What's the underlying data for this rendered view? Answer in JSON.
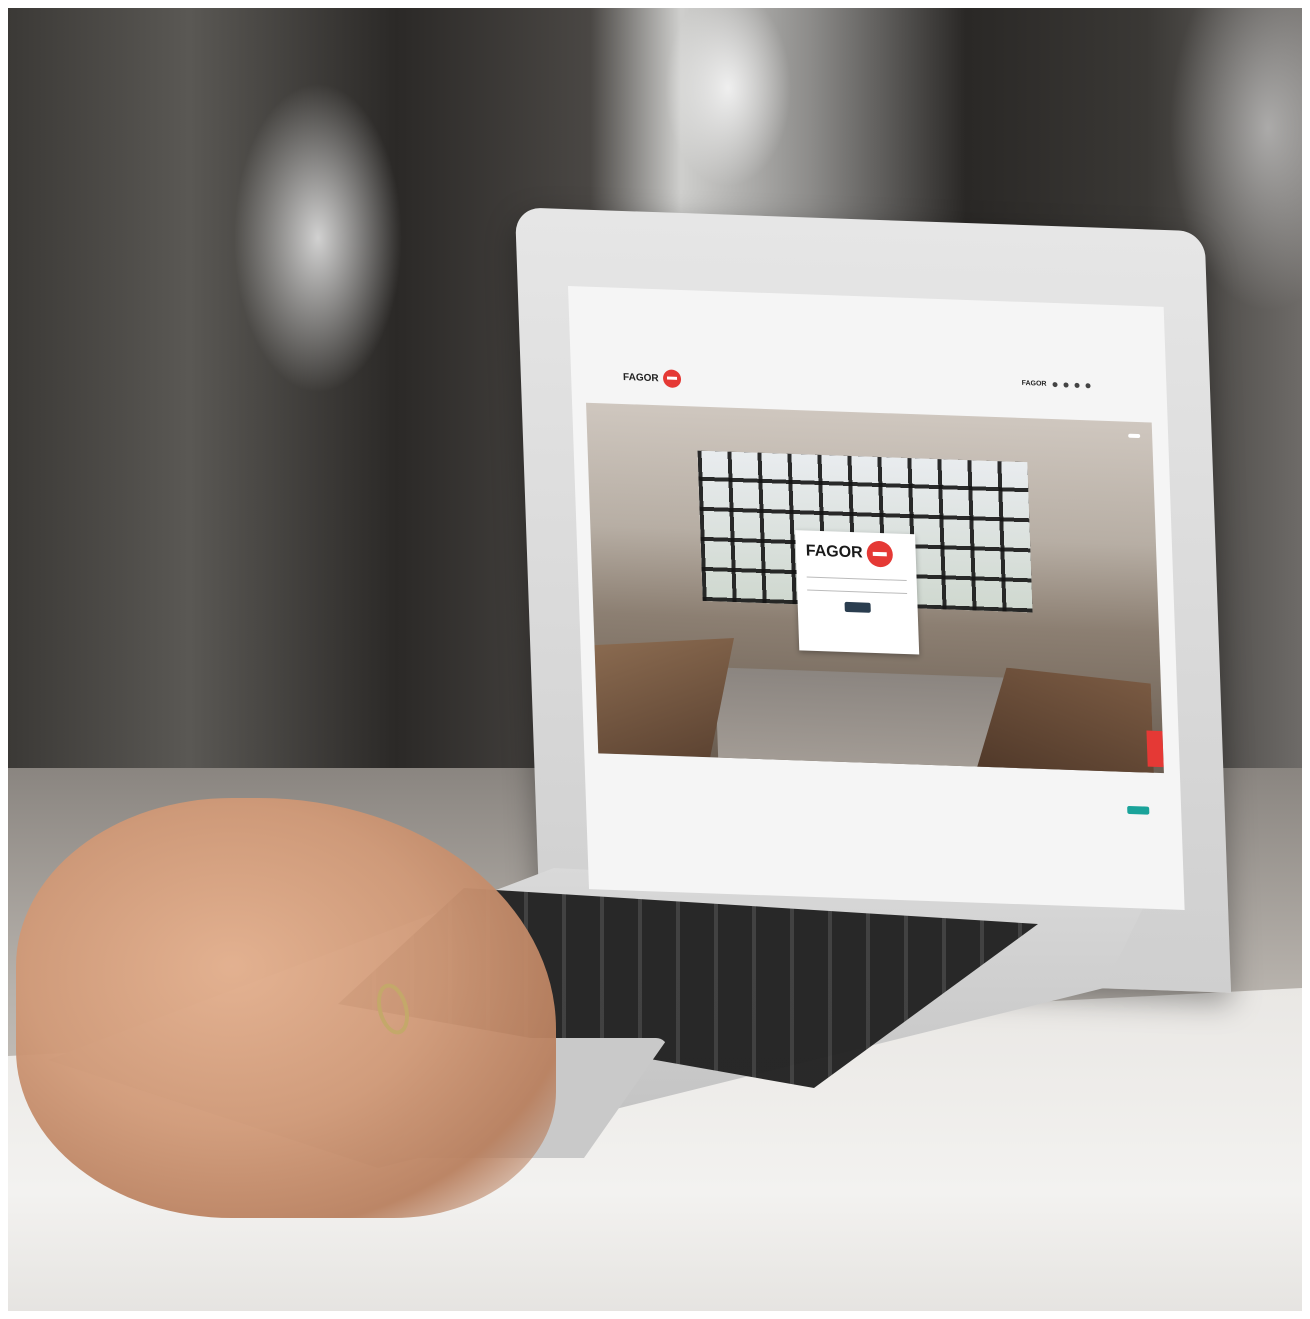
{
  "scene": {
    "description_role": "photo",
    "laptop_screen": {
      "brand": "FAGOR",
      "lang_top": "",
      "brand_strip": {
        "brand_name": "FAGOR"
      },
      "nav": {
        "items": [
          "",
          "",
          "",
          "",
          "",
          "",
          ""
        ],
        "active_index": 1
      },
      "hero": {
        "lang_badge": "",
        "caption": "",
        "login": {
          "logo_text": "FAGOR",
          "field1_label": "",
          "field2_label": ""
        }
      }
    }
  },
  "colors": {
    "brand_red": "#e53935",
    "login_button": "#2a3d4f",
    "teal_button": "#1aa39a"
  },
  "icons": {
    "logo": "fagor-logo-icon",
    "pin": "map-pin-icon"
  }
}
